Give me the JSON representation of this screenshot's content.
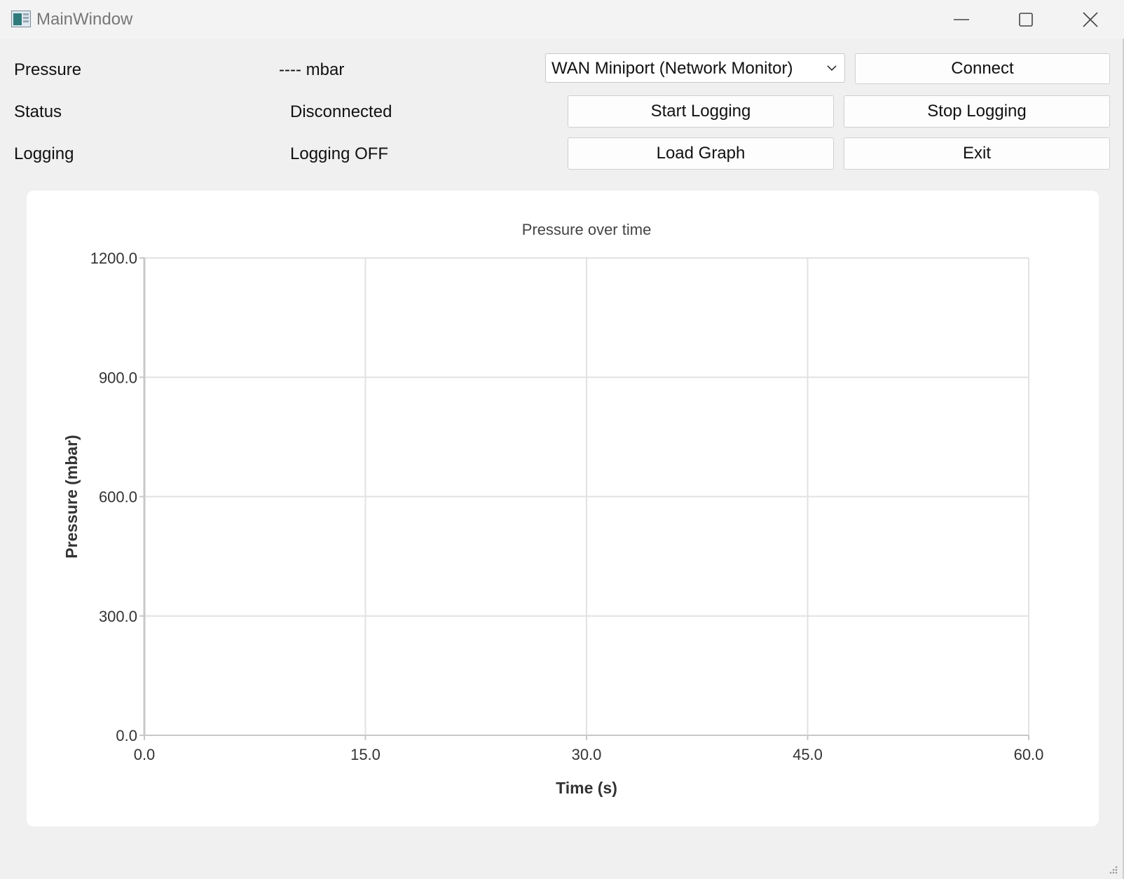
{
  "window": {
    "title": "MainWindow"
  },
  "rows": [
    {
      "label": "Pressure",
      "value": "---- mbar"
    },
    {
      "label": "Status",
      "value": "Disconnected"
    },
    {
      "label": "Logging",
      "value": "Logging OFF"
    }
  ],
  "device_select": {
    "selected": "WAN Miniport (Network Monitor)"
  },
  "buttons": {
    "connect": "Connect",
    "start_logging": "Start Logging",
    "stop_logging": "Stop Logging",
    "load_graph": "Load Graph",
    "exit": "Exit"
  },
  "icons": {
    "app": "app-window-icon",
    "minimize": "minimize-icon",
    "maximize": "maximize-icon",
    "close": "close-icon",
    "dropdown": "chevron-down-icon"
  },
  "chart_data": {
    "type": "line",
    "title": "Pressure over time",
    "xlabel": "Time (s)",
    "ylabel": "Pressure (mbar)",
    "xlim": [
      0,
      60
    ],
    "ylim": [
      0,
      1200
    ],
    "x_ticks": [
      "0.0",
      "15.0",
      "30.0",
      "45.0",
      "60.0"
    ],
    "y_ticks": [
      "0.0",
      "300.0",
      "600.0",
      "900.0",
      "1200.0"
    ],
    "grid": true,
    "series": []
  }
}
